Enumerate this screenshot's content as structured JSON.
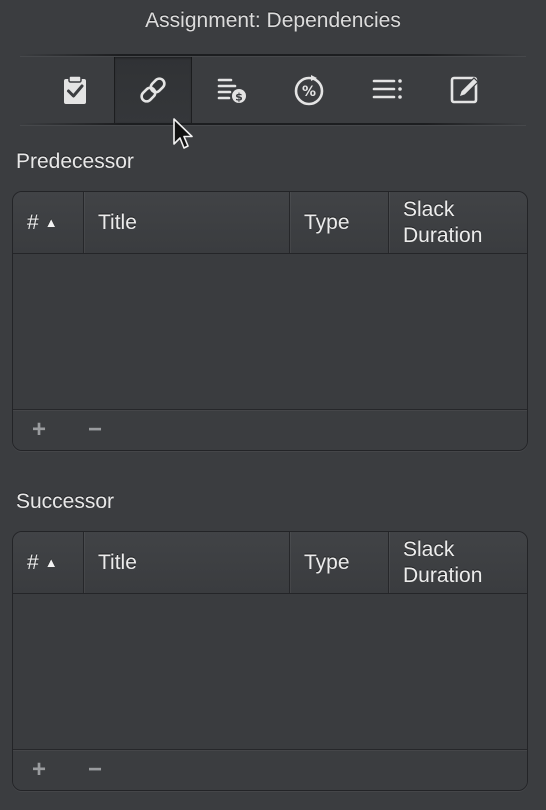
{
  "window": {
    "title": "Assignment: Dependencies"
  },
  "toolbar": {
    "tools": [
      {
        "name": "clipboard-check-icon",
        "active": false
      },
      {
        "name": "link-icon",
        "active": true
      },
      {
        "name": "cost-list-icon",
        "active": false
      },
      {
        "name": "percent-progress-icon",
        "active": false
      },
      {
        "name": "list-icon",
        "active": false
      },
      {
        "name": "edit-icon",
        "active": false
      }
    ]
  },
  "predecessor": {
    "label": "Predecessor",
    "columns": {
      "number": "#",
      "title": "Title",
      "type": "Type",
      "slack_line1": "Slack",
      "slack_line2": "Duration"
    },
    "sort_indicator": "▲",
    "rows": [],
    "add_label": "+",
    "remove_label": "−"
  },
  "successor": {
    "label": "Successor",
    "columns": {
      "number": "#",
      "title": "Title",
      "type": "Type",
      "slack_line1": "Slack",
      "slack_line2": "Duration"
    },
    "sort_indicator": "▲",
    "rows": [],
    "add_label": "+",
    "remove_label": "−"
  },
  "colors": {
    "background": "#3b3d40",
    "text": "#e6e6e6",
    "icon": "#e2e2e2",
    "border": "#232427"
  }
}
